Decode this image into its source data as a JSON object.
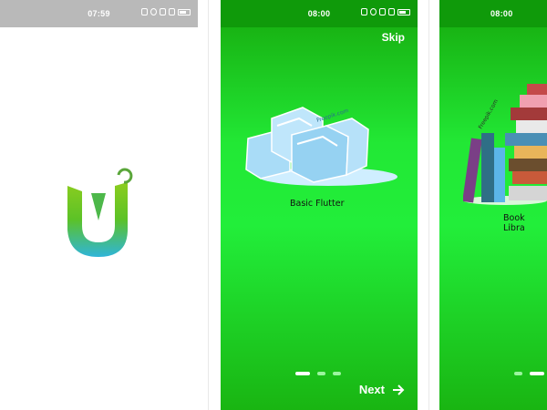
{
  "phones": [
    {
      "screen": "splash",
      "status_bar": {
        "time": "07:59"
      }
    },
    {
      "screen": "onboarding",
      "status_bar": {
        "time": "08:00"
      },
      "skip_label": "Skip",
      "slide_caption": "Basic Flutter",
      "watermark": "Freepik.com",
      "next_label": "Next",
      "page_indicator": {
        "total": 3,
        "active": 1
      }
    },
    {
      "screen": "onboarding",
      "status_bar": {
        "time": "08:00"
      },
      "slide_caption": "Book Libra",
      "watermark": "Freepik.com",
      "page_indicator": {
        "total": 3,
        "active": 2
      }
    }
  ],
  "icons": [
    "mute-icon",
    "alarm-icon",
    "wifi-icon",
    "signal-icon",
    "battery-icon",
    "arrow-right-icon",
    "app-logo"
  ],
  "colors": {
    "splash_background": "#ffffff",
    "splash_status_bar": "#b9b9b9",
    "onboarding_green": "#22e835",
    "onboarding_dark_green": "#0f9a0a",
    "logo_green": "#5cc227",
    "logo_blue": "#2fb5d9"
  }
}
